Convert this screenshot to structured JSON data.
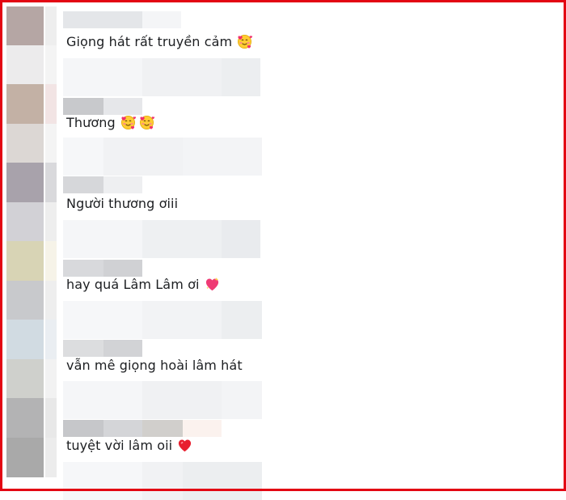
{
  "thread": {
    "comments": [
      {
        "text": "Giọng hát rất truyền cảm",
        "emojis": [
          "smiling-face-with-hearts"
        ]
      },
      {
        "text": "Thương",
        "emojis": [
          "smiling-face-with-hearts",
          "smiling-face-with-hearts"
        ]
      },
      {
        "text": "Người thương ơiii",
        "emojis": []
      },
      {
        "text": "hay quá Lâm Lâm ơi",
        "emojis": [
          "sparkling-heart"
        ]
      },
      {
        "text": "vẫn mê giọng hoài lâm hát",
        "emojis": []
      },
      {
        "text": "tuyệt vời lâm oii",
        "emojis": [
          "red-heart"
        ]
      }
    ]
  },
  "colors": {
    "frame_border": "#e30613",
    "comment_text": "#1c1e21",
    "blur_light": "#f0f2f5",
    "blur_mid": "#e4e6e9",
    "blur_dark": "#c8c9cc"
  }
}
